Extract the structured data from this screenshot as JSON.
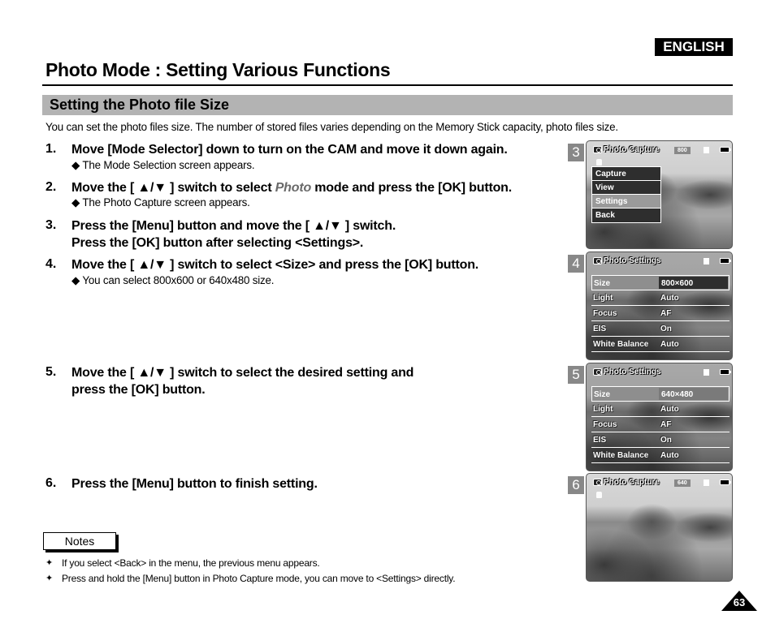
{
  "language_badge": "ENGLISH",
  "page_title": "Photo Mode : Setting Various Functions",
  "section_title": "Setting the Photo file Size",
  "intro": "You can set the photo files size. The number of stored files varies depending on the Memory Stick capacity, photo files size.",
  "steps": [
    {
      "num": "1.",
      "lines": [
        "Move [Mode Selector] down to turn on the CAM and move it down again."
      ],
      "sub": "◆ The Mode Selection screen appears."
    },
    {
      "num": "2.",
      "pre": "Move the [ ▲/▼ ] switch to select ",
      "em": "Photo",
      "post": " mode and press the [OK] button.",
      "sub": "◆ The Photo Capture screen appears."
    },
    {
      "num": "3.",
      "lines": [
        "Press the [Menu] button and move the [ ▲/▼ ] switch.",
        "Press the [OK] button after selecting <Settings>."
      ]
    },
    {
      "num": "4.",
      "lines": [
        "Move the [ ▲/▼ ] switch to select <Size> and press the [OK] button."
      ],
      "sub": "◆ You can select 800x600 or 640x480 size."
    },
    {
      "num": "5.",
      "lines": [
        "Move the [ ▲/▼ ] switch to select the desired setting and",
        "press the [OK] button."
      ]
    },
    {
      "num": "6.",
      "lines": [
        "Press the [Menu] button to finish setting."
      ]
    }
  ],
  "screens": [
    {
      "num": "3",
      "title": "Photo Capture",
      "res": "800",
      "menu": [
        {
          "label": "Capture"
        },
        {
          "label": "View"
        },
        {
          "label": "Settings",
          "selected": true
        },
        {
          "label": "Back"
        }
      ]
    },
    {
      "num": "4",
      "title": "Photo Settings",
      "settings": [
        {
          "label": "Size",
          "value": "800×600"
        },
        {
          "label": "Light",
          "value": "Auto"
        },
        {
          "label": "Focus",
          "value": "AF"
        },
        {
          "label": "EIS",
          "value": "On"
        },
        {
          "label": "White Balance",
          "value": "Auto"
        }
      ]
    },
    {
      "num": "5",
      "title": "Photo Settings",
      "settings": [
        {
          "label": "Size",
          "value": "640×480"
        },
        {
          "label": "Light",
          "value": "Auto"
        },
        {
          "label": "Focus",
          "value": "AF"
        },
        {
          "label": "EIS",
          "value": "On"
        },
        {
          "label": "White Balance",
          "value": "Auto"
        }
      ]
    },
    {
      "num": "6",
      "title": "Photo Capture",
      "res": "640"
    }
  ],
  "notes": {
    "label": "Notes",
    "bullet": "✦",
    "items": [
      "If you select <Back> in the menu, the previous menu appears.",
      "Press and hold the [Menu] button in Photo Capture mode, you can move to <Settings> directly."
    ]
  },
  "page_number": "63"
}
